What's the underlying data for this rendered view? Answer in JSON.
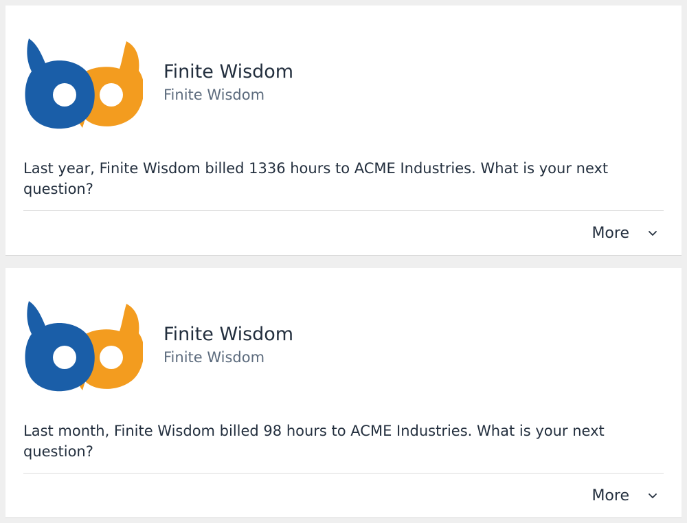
{
  "cards": [
    {
      "logo_icon": "finite-wisdom-owl-logo",
      "title": "Finite Wisdom",
      "subtitle": "Finite Wisdom",
      "body": "Last year, Finite Wisdom billed 1336 hours to ACME Industries. What is your next question?",
      "more_label": "More",
      "more_icon": "chevron-down-icon"
    },
    {
      "logo_icon": "finite-wisdom-owl-logo",
      "title": "Finite Wisdom",
      "subtitle": "Finite Wisdom",
      "body": "Last month, Finite Wisdom billed 98 hours to ACME Industries. What is your next question?",
      "more_label": "More",
      "more_icon": "chevron-down-icon"
    }
  ],
  "colors": {
    "logo_blue": "#1a5ea8",
    "logo_orange": "#f39c1f",
    "text_primary": "#232f3e",
    "text_secondary": "#5c6b7d",
    "background": "#efefef",
    "card": "#ffffff"
  }
}
